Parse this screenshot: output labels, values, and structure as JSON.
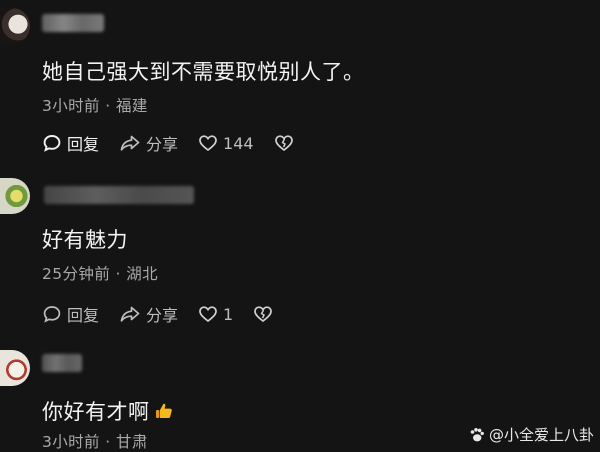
{
  "comments": [
    {
      "text": "她自己强大到不需要取悦别人了。",
      "meta": "3小时前 · 福建",
      "reply_label": "回复",
      "share_label": "分享",
      "like_count": "144"
    },
    {
      "text": "好有魅力",
      "meta": "25分钟前 · 湖北",
      "reply_label": "回复",
      "share_label": "分享",
      "like_count": "1"
    },
    {
      "text": "你好有才啊",
      "meta": "3小时前 · 甘肃"
    }
  ],
  "watermark": "@小全爱上八卦",
  "icons": {
    "reply": "reply-bubble-icon",
    "share": "share-arrow-icon",
    "like": "heart-icon",
    "dislike": "broken-heart-icon",
    "thumbs_up": "thumbs-up-emoji",
    "watermark": "paw-icon"
  },
  "colors": {
    "background": "#141414",
    "text": "#f3f3f3",
    "meta": "#a9a9a9"
  }
}
